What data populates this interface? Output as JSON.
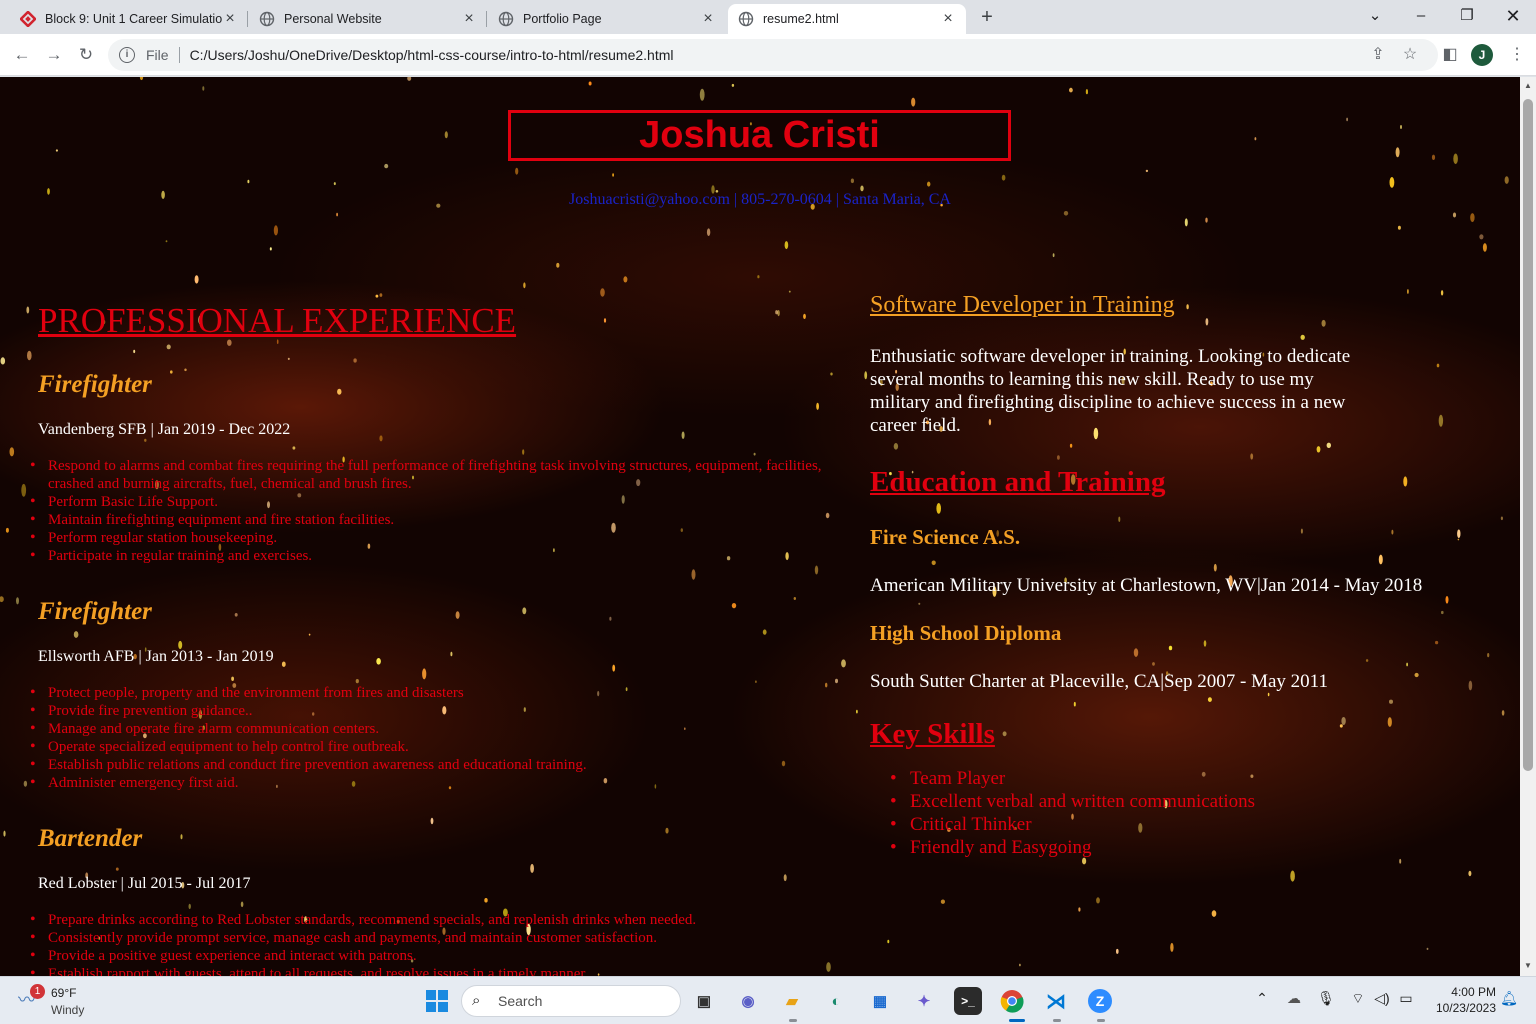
{
  "browser": {
    "tabs": [
      {
        "title": "Block 9: Unit 1 Career Simulatio",
        "icon": "red-diamond-icon",
        "active": false
      },
      {
        "title": "Personal Website",
        "icon": "globe-icon",
        "active": false
      },
      {
        "title": "Portfolio Page",
        "icon": "globe-icon",
        "active": false
      },
      {
        "title": "resume2.html",
        "icon": "globe-icon",
        "active": true
      }
    ],
    "address": {
      "scheme": "File",
      "url": "C:/Users/Joshu/OneDrive/Desktop/html-css-course/intro-to-html/resume2.html"
    },
    "profile_initial": "J"
  },
  "resume": {
    "name": "Joshua Cristi",
    "contact": "Joshuacristi@yahoo.com | 805-270-0604 | Santa Maria, CA",
    "experience_heading": "PROFESSIONAL EXPERIENCE",
    "jobs": [
      {
        "title": "Firefighter",
        "meta": "Vandenberg SFB | Jan 2019 - Dec 2022",
        "duties": [
          "Respond to alarms and combat fires requiring the full performance of firefighting task involving structures, equipment, facilities, crashed and burning aircrafts, fuel, chemical and brush fires.",
          "Perform Basic Life Support.",
          "Maintain firefighting equipment and fire station facilities.",
          "Perform regular station housekeeping.",
          "Participate in regular training and exercises."
        ]
      },
      {
        "title": "Firefighter",
        "meta": "Ellsworth AFB | Jan 2013 - Jan 2019",
        "duties": [
          "Protect people, property and the environment from fires and disasters",
          "Provide fire prevention guidance..",
          "Manage and operate fire alarm communication centers.",
          "Operate specialized equipment to help control fire outbreak.",
          "Establish public relations and conduct fire prevention awareness and educational training.",
          "Administer emergency first aid."
        ]
      },
      {
        "title": "Bartender",
        "meta": "Red Lobster | Jul 2015 - Jul 2017",
        "duties": [
          "Prepare drinks according to Red Lobster standards, recommend specials, and replenish drinks when needed.",
          "Consistently provide prompt service, manage cash and payments, and maintain customer satisfaction.",
          "Provide a positive guest experience and interact with patrons.",
          "Establish rapport with guests, attend to all requests, and resolve issues in a timely manner."
        ]
      }
    ],
    "objective_heading": "Software Developer in Training",
    "objective": "Enthusiatic software developer in training. Looking to dedicate several months to learning this new skill. Ready to use my military and firefighting discipline to achieve success in a new career field.",
    "education_heading": "Education and Training",
    "education": [
      {
        "degree": "Fire Science A.S.",
        "school": "American Military University at Charlestown, WV|Jan 2014 - May 2018"
      },
      {
        "degree": "High School Diploma",
        "school": "South Sutter Charter at Placeville, CA|Sep 2007 - May 2011"
      }
    ],
    "skills_heading": "Key Skills",
    "skills": [
      "Team Player",
      "Excellent verbal and written communications",
      "Critical Thinker",
      "Friendly and Easygoing"
    ]
  },
  "taskbar": {
    "weather": {
      "temp": "69°F",
      "condition": "Windy",
      "badge": "1"
    },
    "search_label": "Search",
    "time": "4:00 PM",
    "date": "10/23/2023"
  },
  "colors": {
    "name_red": "#e1000f",
    "job_title_orange": "#f4a024",
    "contact_blue": "#1a23c8",
    "background": "#120402"
  }
}
